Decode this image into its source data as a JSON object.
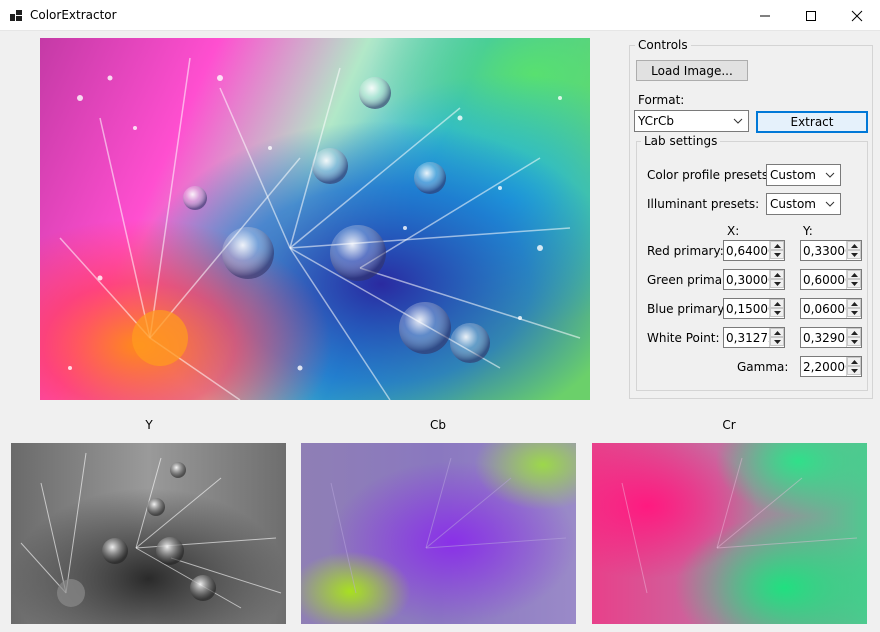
{
  "window": {
    "title": "ColorExtractor"
  },
  "icons": {
    "app": "app-window-icon",
    "minimize": "minimize-icon",
    "maximize": "maximize-icon",
    "close": "close-icon",
    "dropdown": "chevron-down-icon",
    "spin_up": "spin-up-arrow-icon",
    "spin_down": "spin-down-arrow-icon"
  },
  "channels": {
    "y_label": "Y",
    "cb_label": "Cb",
    "cr_label": "Cr"
  },
  "controls": {
    "group_title": "Controls",
    "load_button": "Load Image...",
    "format_label": "Format:",
    "format_value": "YCrCb",
    "extract_button": "Extract"
  },
  "lab": {
    "group_title": "Lab settings",
    "color_profile_label": "Color profile presets:",
    "color_profile_value": "Custom",
    "illuminant_label": "Illuminant presets:",
    "illuminant_value": "Custom",
    "x_header": "X:",
    "y_header": "Y:",
    "rows": [
      {
        "label": "Red primary:",
        "x": "0,64000",
        "y": "0,33000"
      },
      {
        "label": "Green primary:",
        "x": "0,30000",
        "y": "0,60000"
      },
      {
        "label": "Blue primary:",
        "x": "0,15000",
        "y": "0,06000"
      },
      {
        "label": "White Point:",
        "x": "0,31272",
        "y": "0,32903"
      }
    ],
    "gamma_label": "Gamma:",
    "gamma_value": "2,20000"
  },
  "colors": {
    "accent": "#0078d7",
    "window_bg": "#f0f0f0",
    "button_bg": "#e1e1e1"
  }
}
